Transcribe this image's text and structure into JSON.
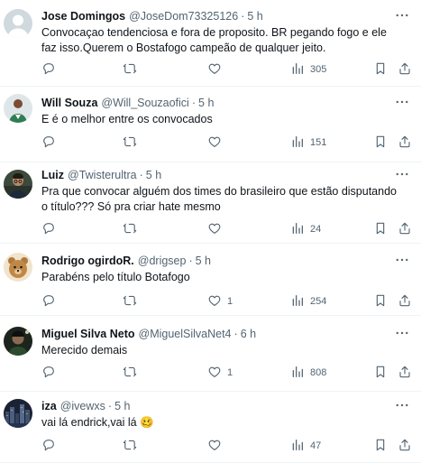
{
  "tweets": [
    {
      "name": "Jose Domingos",
      "handle": "@JoseDom73325126",
      "separator": "·",
      "time": "5 h",
      "text": "Convocaçao tendenciosa e fora de proposito. BR pegando fogo e ele faz isso.Querem o Bostafogo campeão de qualquer jeito.",
      "replies": "",
      "reposts": "",
      "likes": "",
      "views": "305",
      "avatar": "default-avatar"
    },
    {
      "name": "Will Souza",
      "handle": "@Will_Souzaofici",
      "separator": "·",
      "time": "5 h",
      "text": "E é o melhor entre os convocados",
      "replies": "",
      "reposts": "",
      "likes": "",
      "views": "151",
      "avatar": "green-shirt-player-avatar"
    },
    {
      "name": "Luiz",
      "handle": "@Twisterultra",
      "separator": "·",
      "time": "5 h",
      "text": "Pra que convocar alguém dos times do brasileiro que estão disputando o título??? Só pra criar hate mesmo",
      "replies": "",
      "reposts": "",
      "likes": "",
      "views": "24",
      "avatar": "man-photo-avatar"
    },
    {
      "name": "Rodrigo ogirdoR.",
      "handle": "@drigsep",
      "separator": "·",
      "time": "5 h",
      "text": "Parabéns pelo título Botafogo",
      "replies": "",
      "reposts": "",
      "likes": "1",
      "views": "254",
      "avatar": "cartoon-bear-avatar"
    },
    {
      "name": "Miguel Silva Neto",
      "handle": "@MiguelSilvaNet4",
      "separator": "·",
      "time": "6 h",
      "text": "Merecido demais",
      "replies": "",
      "reposts": "",
      "likes": "1",
      "views": "808",
      "avatar": "dark-selfie-avatar"
    },
    {
      "name": "iza",
      "handle": "@ivewxs",
      "separator": "·",
      "time": "5 h",
      "text": "vai lá endrick,vai lá 🥴",
      "replies": "",
      "reposts": "",
      "likes": "",
      "views": "47",
      "avatar": "city-night-avatar"
    }
  ],
  "colors": {
    "text": "#0f1419",
    "muted": "#536471",
    "border": "#eff3f4"
  },
  "icons": [
    "more-icon",
    "reply-icon",
    "repost-icon",
    "like-icon",
    "views-icon",
    "bookmark-icon",
    "share-icon"
  ]
}
